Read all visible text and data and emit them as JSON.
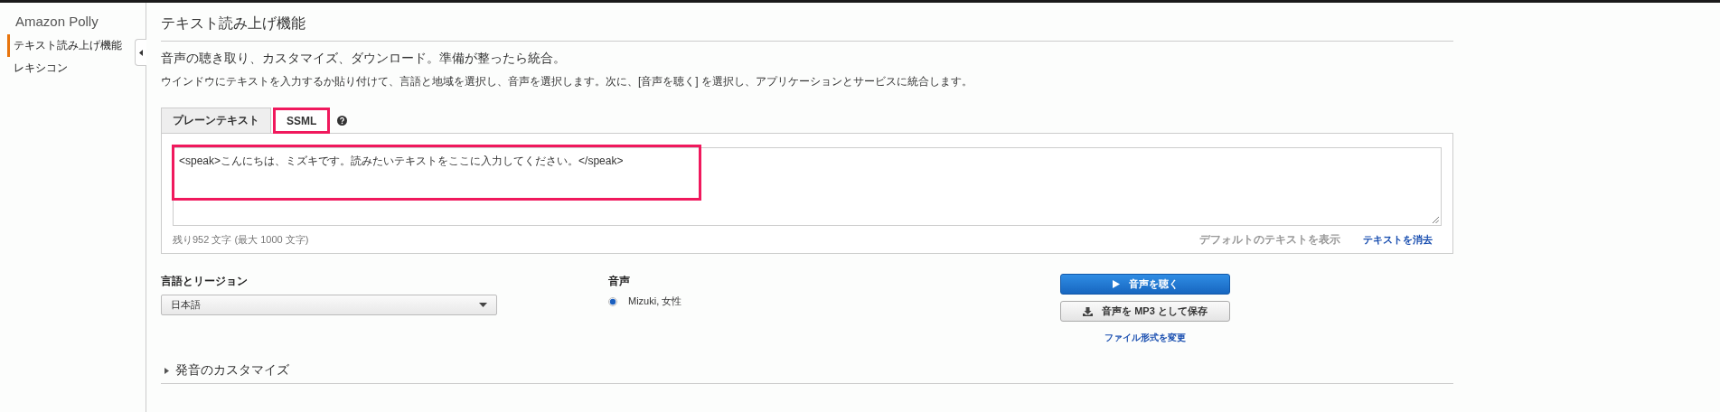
{
  "sidebar": {
    "title": "Amazon Polly",
    "items": [
      {
        "label": "テキスト読み上げ機能",
        "selected": true
      },
      {
        "label": "レキシコン",
        "selected": false
      }
    ]
  },
  "page": {
    "title": "テキスト読み上げ機能",
    "subtitle": "音声の聴き取り、カスタマイズ、ダウンロード。準備が整ったら統合。",
    "description": "ウインドウにテキストを入力するか貼り付けて、言語と地域を選択し、音声を選択します。次に、[音声を聴く] を選択し、アプリケーションとサービスに統合します。"
  },
  "tabs": [
    {
      "label": "プレーンテキスト",
      "selected": false,
      "highlighted": false
    },
    {
      "label": "SSML",
      "selected": true,
      "highlighted": true
    }
  ],
  "editor": {
    "value": "<speak>こんにちは、ミズキです。読みたいテキストをここに入力してください。</speak>",
    "highlighted": true,
    "counter": "残り952 文字 (最大 1000 文字)",
    "show_default": "デフォルトのテキストを表示",
    "clear": "テキストを消去"
  },
  "language": {
    "label": "言語とリージョン",
    "value": "日本語"
  },
  "voice": {
    "label": "音声",
    "options": [
      {
        "label": "Mizuki, 女性",
        "selected": true
      }
    ]
  },
  "buttons": [
    {
      "label": "音声を聴く",
      "kind": "primary"
    },
    {
      "label": "音声を MP3 として保存",
      "kind": "download"
    }
  ],
  "change_format": "ファイル形式を変更",
  "customize": {
    "label": "発音のカスタマイズ",
    "expanded": false
  }
}
